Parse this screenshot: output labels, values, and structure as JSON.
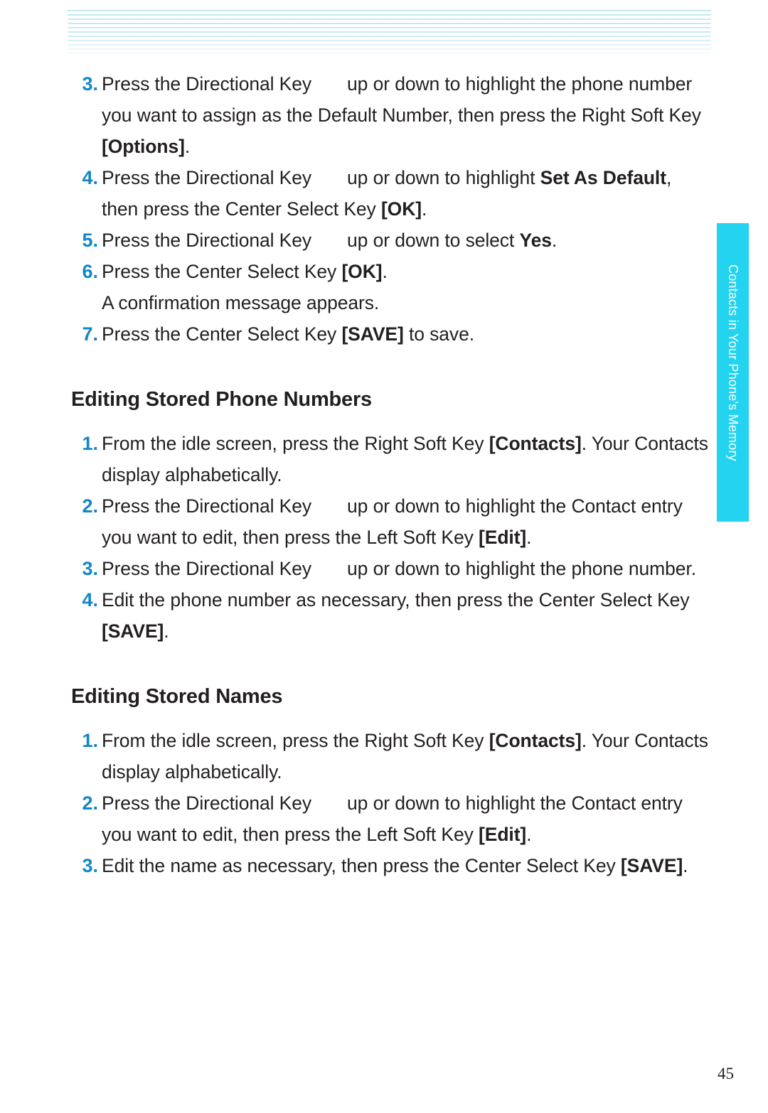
{
  "side_tab": {
    "label": "Contacts in Your Phone's Memory",
    "color": "#23d3ef"
  },
  "page_number": "45",
  "accent_color": "#1287c8",
  "sections": [
    {
      "id": "default-number-steps",
      "heading": null,
      "items": [
        {
          "num": "3.",
          "parts": [
            {
              "t": "Press the Directional Key",
              "b": false
            },
            {
              "t": "GAP",
              "b": false
            },
            {
              "t": "up or down to highlight the phone number you want to assign as the Default Number, then press the Right Soft Key ",
              "b": false
            },
            {
              "t": "[Options]",
              "b": true
            },
            {
              "t": ".",
              "b": false
            }
          ]
        },
        {
          "num": "4.",
          "parts": [
            {
              "t": "Press the Directional Key",
              "b": false
            },
            {
              "t": "GAP",
              "b": false
            },
            {
              "t": "up or down to highlight ",
              "b": false
            },
            {
              "t": "Set As Default",
              "b": true
            },
            {
              "t": ", then press the Center Select Key ",
              "b": false
            },
            {
              "t": "[OK]",
              "b": true
            },
            {
              "t": ".",
              "b": false
            }
          ]
        },
        {
          "num": "5.",
          "parts": [
            {
              "t": "Press the Directional Key",
              "b": false
            },
            {
              "t": "GAP",
              "b": false
            },
            {
              "t": "up or down to select ",
              "b": false
            },
            {
              "t": "Yes",
              "b": true
            },
            {
              "t": ".",
              "b": false
            }
          ]
        },
        {
          "num": "6.",
          "parts": [
            {
              "t": "Press the Center Select Key ",
              "b": false
            },
            {
              "t": "[OK]",
              "b": true
            },
            {
              "t": ".",
              "b": false
            }
          ]
        },
        {
          "num": "",
          "parts": [
            {
              "t": "A confirmation message appears.",
              "b": false
            }
          ]
        },
        {
          "num": "7.",
          "parts": [
            {
              "t": "Press the Center Select Key ",
              "b": false
            },
            {
              "t": "[SAVE]",
              "b": true
            },
            {
              "t": " to save.",
              "b": false
            }
          ]
        }
      ]
    },
    {
      "id": "editing-stored-phone-numbers",
      "heading": "Editing Stored Phone Numbers",
      "items": [
        {
          "num": "1.",
          "parts": [
            {
              "t": "From the idle screen, press the Right Soft Key ",
              "b": false
            },
            {
              "t": "[Contacts]",
              "b": true
            },
            {
              "t": ". Your Contacts display alphabetically.",
              "b": false
            }
          ]
        },
        {
          "num": "2.",
          "parts": [
            {
              "t": "Press the Directional Key",
              "b": false
            },
            {
              "t": "GAP",
              "b": false
            },
            {
              "t": "up or down to highlight the Contact entry you want to edit, then press the Left Soft Key ",
              "b": false
            },
            {
              "t": "[Edit]",
              "b": true
            },
            {
              "t": ".",
              "b": false
            }
          ]
        },
        {
          "num": "3.",
          "parts": [
            {
              "t": "Press the Directional Key",
              "b": false
            },
            {
              "t": "GAP",
              "b": false
            },
            {
              "t": "up or down to highlight the phone number.",
              "b": false
            }
          ]
        },
        {
          "num": "4.",
          "parts": [
            {
              "t": "Edit the phone number as necessary, then press the Center Select Key ",
              "b": false
            },
            {
              "t": "[SAVE]",
              "b": true
            },
            {
              "t": ".",
              "b": false
            }
          ]
        }
      ]
    },
    {
      "id": "editing-stored-names",
      "heading": "Editing Stored Names",
      "items": [
        {
          "num": "1.",
          "parts": [
            {
              "t": "From the idle screen, press the Right Soft Key ",
              "b": false
            },
            {
              "t": "[Contacts]",
              "b": true
            },
            {
              "t": ". Your Contacts display alphabetically.",
              "b": false
            }
          ]
        },
        {
          "num": "2.",
          "parts": [
            {
              "t": "Press the Directional Key",
              "b": false
            },
            {
              "t": "GAP",
              "b": false
            },
            {
              "t": "up or down to highlight the Contact entry you want to edit, then press the Left Soft Key ",
              "b": false
            },
            {
              "t": "[Edit]",
              "b": true
            },
            {
              "t": ".",
              "b": false
            }
          ]
        },
        {
          "num": "3.",
          "parts": [
            {
              "t": "Edit the name as necessary, then press the Center Select Key ",
              "b": false
            },
            {
              "t": "[SAVE]",
              "b": true
            },
            {
              "t": ".",
              "b": false
            }
          ]
        }
      ]
    }
  ]
}
